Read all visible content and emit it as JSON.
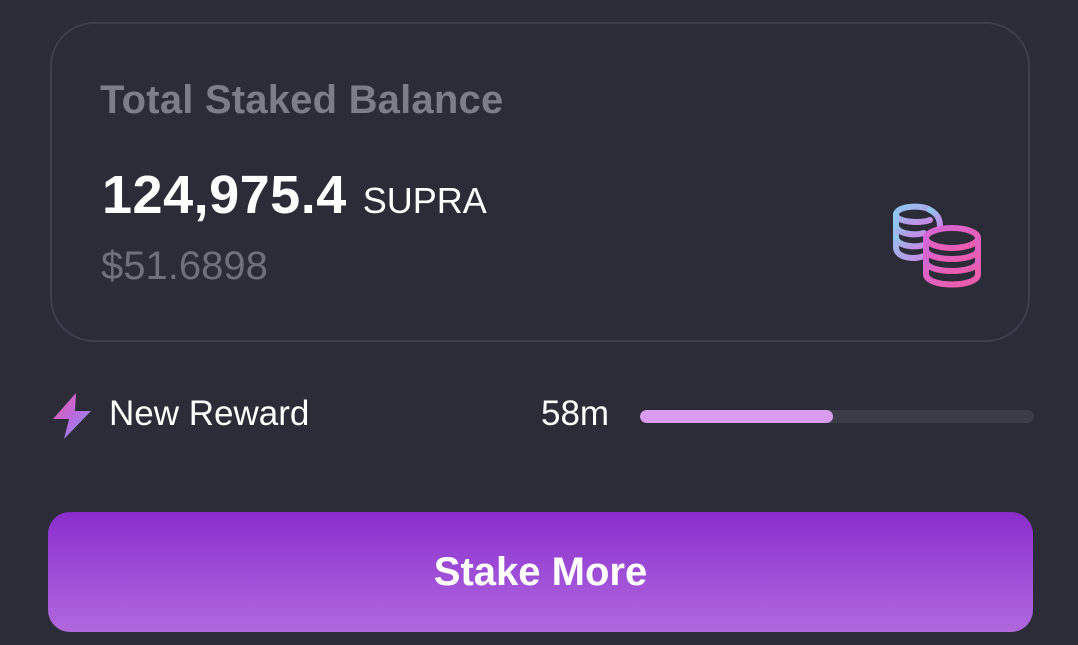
{
  "balance_card": {
    "title": "Total Staked Balance",
    "amount": "124,975.4",
    "unit": "SUPRA",
    "usd_value": "$51.6898",
    "icon": "coins-stack-icon"
  },
  "reward": {
    "icon": "lightning-bolt-icon",
    "label": "New Reward",
    "time_remaining": "58m",
    "progress_fraction": 0.49
  },
  "actions": {
    "stake_more_label": "Stake More"
  },
  "colors": {
    "background": "#2b2c38",
    "card_border": "#3c3e4c",
    "muted_text": "#7c7d88",
    "progress_fill": "#d99cf0",
    "progress_track": "#3b3c48",
    "button_gradient_top": "#8a2ccc",
    "button_gradient_bottom": "#b068dd"
  }
}
